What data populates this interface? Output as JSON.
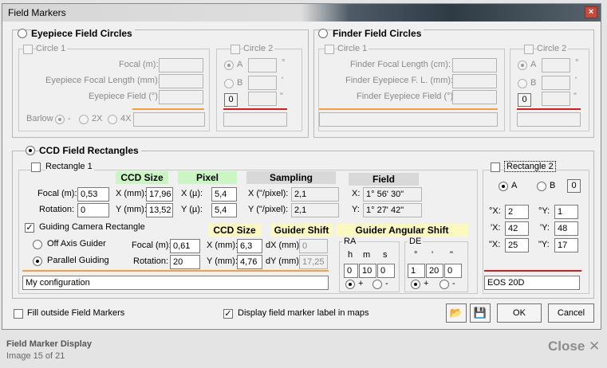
{
  "window": {
    "title": "Field Markers",
    "close_glyph": "×"
  },
  "eyepiece": {
    "title": "Eyepiece Field Circles",
    "circle1": "Circle 1",
    "circle2": "Circle 2",
    "focal_label": "Focal (m):",
    "efl_label": "Eyepiece Focal Length (mm):",
    "field_label": "Eyepiece Field (°)",
    "barlow_label": "Barlow",
    "barlow_opt1": "-",
    "barlow_opt2": "2X",
    "barlow_opt3": "4X",
    "opt_a": "A",
    "opt_b": "B",
    "unit_deg": "°",
    "unit_min": "'",
    "unit_sec": "\"",
    "zero_btn": "0"
  },
  "finder": {
    "title": "Finder Field Circles",
    "circle1": "Circle 1",
    "circle2": "Circle 2",
    "ffl_label": "Finder Focal Length (cm):",
    "fefl_label": "Finder Eyepiece F. L. (mm):",
    "fef_label": "Finder Eyepiece Field (°)",
    "opt_a": "A",
    "opt_b": "B",
    "unit_deg": "°",
    "unit_min": "'",
    "unit_sec": "\"",
    "zero_btn": "0"
  },
  "ccd": {
    "title": "CCD Field Rectangles",
    "rect1": "Rectangle 1",
    "hdr_ccd": "CCD Size",
    "hdr_pixel": "Pixel",
    "hdr_sampling": "Sampling",
    "hdr_field": "Field",
    "focal_label": "Focal (m):",
    "focal_value": "0,53",
    "rotation_label": "Rotation:",
    "rotation_value": "0",
    "x_mm_label": "X (mm):",
    "x_mm_value": "17,96",
    "y_mm_label": "Y (mm):",
    "y_mm_value": "13,52",
    "x_pix_label": "X (µ):",
    "x_pix_value": "5,4",
    "y_pix_label": "Y (µ):",
    "y_pix_value": "5,4",
    "x_samp_label": "X (\"/pixel):",
    "x_samp_value": "2,1",
    "y_samp_label": "Y (\"/pixel):",
    "y_samp_value": "2,1",
    "x_field_label": "X:",
    "x_field_value": "1° 56' 30\"",
    "y_field_label": "Y:",
    "y_field_value": "1° 27' 42\"",
    "guiding_label": "Guiding Camera Rectangle",
    "guiding_check": "✓",
    "off_axis": "Off Axis Guider",
    "parallel": "Parallel Guiding",
    "g_focal_label": "Focal (m):",
    "g_focal_value": "0,61",
    "g_rotation_label": "Rotation:",
    "g_rotation_value": "20",
    "g_hdr_ccd": "CCD Size",
    "g_x_label": "X (mm):",
    "g_x_value": "6,3",
    "g_y_label": "Y (mm):",
    "g_y_value": "4,76",
    "hdr_shift": "Guider Shift",
    "dx_label": "dX (mm):",
    "dx_value": "0",
    "dy_label": "dY (mm):",
    "dy_value": "17,25",
    "hdr_angular": "Guider Angular Shift",
    "ra_title": "RA",
    "ra_h": "h",
    "ra_m": "m",
    "ra_s": "s",
    "ra_h_value": "0",
    "ra_m_value": "10",
    "ra_s_value": "0",
    "de_title": "DE",
    "de_d": "°",
    "de_m": "'",
    "de_s": "\"",
    "de_d_value": "1",
    "de_m_value": "20",
    "de_s_value": "0",
    "plus": "+",
    "minus": "-",
    "config_value": "My configuration"
  },
  "rect2": {
    "label": "Rectangle 2",
    "opt_a": "A",
    "opt_b": "B",
    "zero_btn": "0",
    "x1_label": "°X:",
    "x1_value": "2",
    "y1_label": "°Y:",
    "y1_value": "1",
    "x2_label": "'X:",
    "x2_value": "42",
    "y2_label": "'Y:",
    "y2_value": "48",
    "x3_label": "\"X:",
    "x3_value": "25",
    "y3_label": "\"Y:",
    "y3_value": "17",
    "name_value": "EOS 20D"
  },
  "bottom": {
    "fill_outside": "Fill outside Field Markers",
    "display_label": "Display field marker label in maps",
    "display_check": "✓",
    "ok": "OK",
    "cancel": "Cancel",
    "open_icon": "📂",
    "save_icon": "💾"
  },
  "footer": {
    "title": "Field Marker Display",
    "subtitle": "Image 15 of 21",
    "close": "Close",
    "close_glyph": "✕"
  },
  "colors": {
    "orange": "#f0a040",
    "red": "#cc2020"
  }
}
